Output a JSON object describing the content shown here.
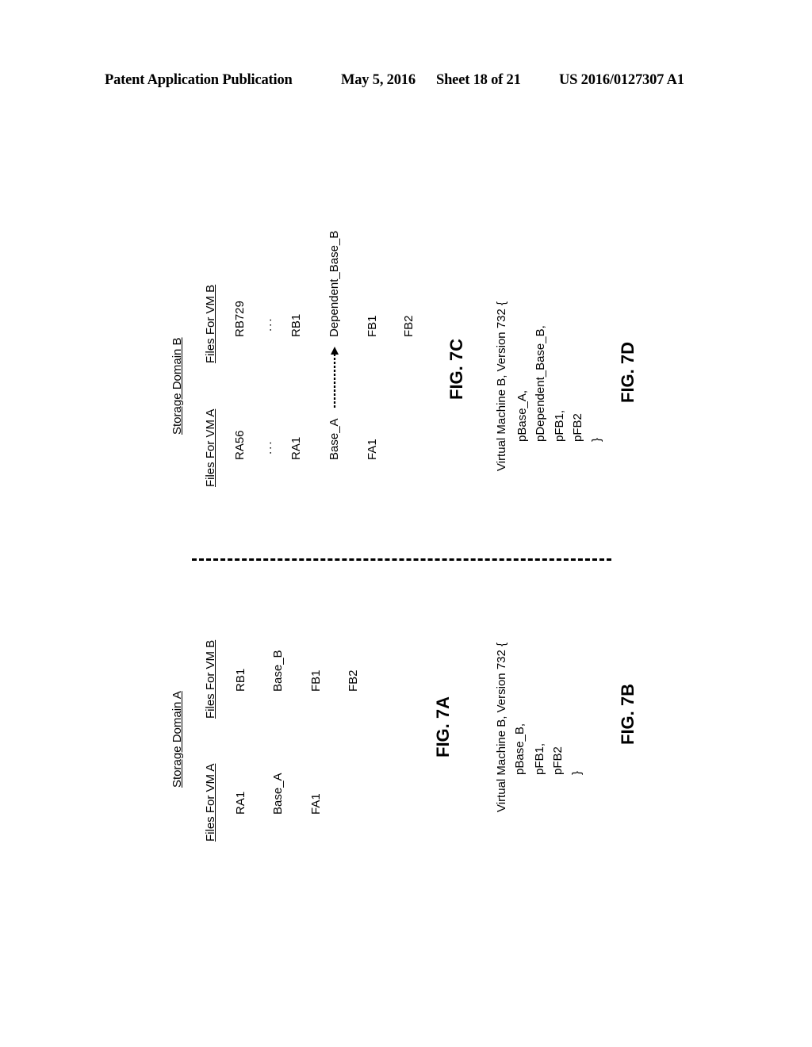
{
  "header": {
    "publication_type": "Patent Application Publication",
    "date": "May 5, 2016",
    "sheet": "Sheet 18 of 21",
    "publication_number": "US 2016/0127307 A1"
  },
  "fig7a": {
    "title": "Storage Domain A",
    "col_a_header": "Files For VM A",
    "col_b_header": "Files For VM B",
    "col_a_items": [
      "RA1",
      "Base_A",
      "FA1"
    ],
    "col_b_items": [
      "RB1",
      "Base_B",
      "FB1",
      "FB2"
    ],
    "label": "FIG. 7A"
  },
  "fig7b": {
    "lines": [
      "Virtual Machine B, Version 732 {",
      "pBase_B,",
      "pFB1,",
      "pFB2",
      "}"
    ],
    "label": "FIG. 7B"
  },
  "fig7c": {
    "title": "Storage Domain B",
    "col_a_header": "Files For VM A",
    "col_b_header": "Files For VM B",
    "col_a_items": [
      "RA56",
      "...",
      "RA1",
      "Base_A",
      "FA1"
    ],
    "col_b_items": [
      "RB729",
      "...",
      "RB1",
      "Dependent_Base_B",
      "FB1",
      "FB2"
    ],
    "arrow": {
      "from": "Base_A",
      "to": "Dependent_Base_B",
      "style": "dashed"
    },
    "label": "FIG. 7C"
  },
  "fig7d": {
    "lines": [
      "Virtual Machine B, Version 732 {",
      "pBase_A,",
      "pDependent_Base_B,",
      "pFB1,",
      "pFB2",
      "}"
    ],
    "label": "FIG. 7D"
  }
}
